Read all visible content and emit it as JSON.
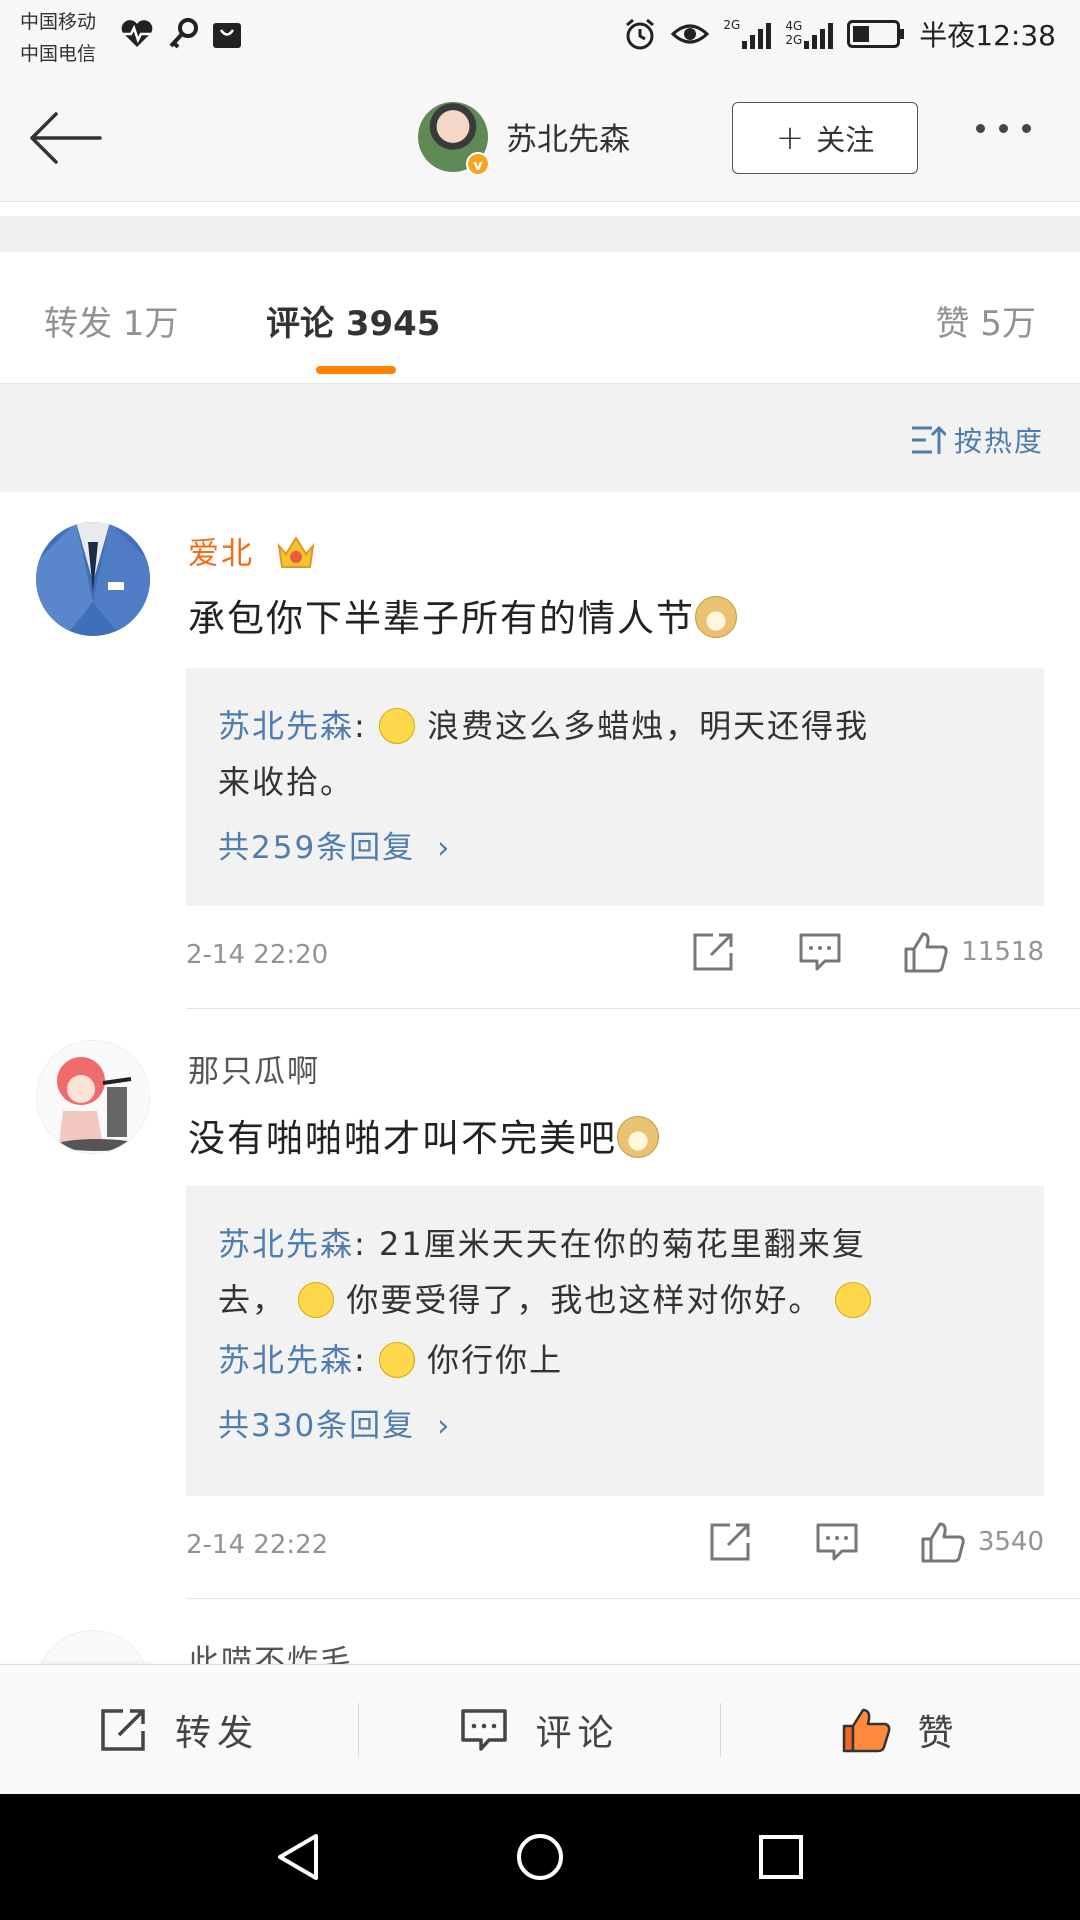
{
  "status_bar": {
    "carrier_1": "中国移动",
    "carrier_2": "中国电信",
    "net_1": "2G",
    "net_2": "4G",
    "net_3": "2G",
    "time": "半夜12:38"
  },
  "header": {
    "username": "苏北先森",
    "follow_label": "关注",
    "follow_plus": "+"
  },
  "tabs": [
    {
      "label": "转发 1万"
    },
    {
      "label": "评论 3945",
      "active": true
    },
    {
      "label": "赞 5万"
    }
  ],
  "sort": {
    "label": "按热度"
  },
  "comments": [
    {
      "name": "爱北",
      "name_color": "#f26d14",
      "text": "承包你下半辈子所有的情人节",
      "replies": [
        {
          "author": "苏北先森",
          "text_1": "浪费这么多蜡烛，明天还得我",
          "text_2": "来收拾。"
        }
      ],
      "reply_count": "共259条回复",
      "time": "2-14 22:20",
      "likes": "11518"
    },
    {
      "name": "那只瓜啊",
      "name_color": "#555555",
      "text": "没有啪啪啪才叫不完美吧",
      "replies": [
        {
          "author": "苏北先森",
          "text_1": "21厘米天天在你的菊花里翻来复",
          "text_2a": "去，",
          "text_2b": "你要受得了，我也这样对你好。"
        },
        {
          "author": "苏北先森",
          "text": "你行你上"
        }
      ],
      "reply_count": "共330条回复",
      "time": "2-14 22:22",
      "likes": "3540"
    },
    {
      "name": "此喵不炸毛"
    }
  ],
  "bottom_bar": {
    "repost": "转发",
    "comment": "评论",
    "like": "赞"
  },
  "colors": {
    "accent_orange": "#ff8200",
    "link_blue": "#507daf",
    "vip_name_orange": "#f26d14"
  }
}
